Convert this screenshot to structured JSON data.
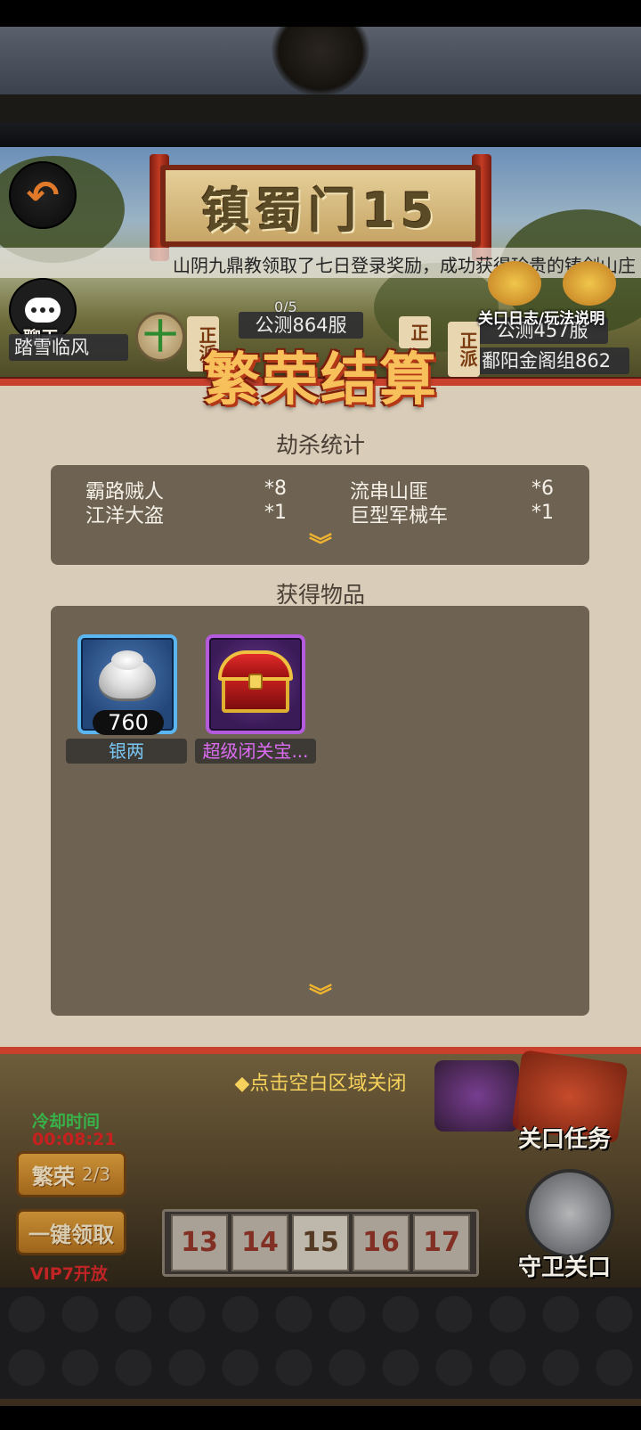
{
  "scene": {
    "back_glyph": "↶",
    "stage_title": "镇蜀门15",
    "broadcast": "山阴九鼎教领取了七日登录奖励，成功获得珍贵的铸剑山庄",
    "chat_label": "聊天",
    "player_name": "踏雪临风",
    "progress": "0/5",
    "server_left": "公测864服",
    "server_right": "公测457服",
    "guild_name": "鄱阳金阁组862",
    "log_label": "关口日志/玩法说明",
    "side_badge_left": "正派",
    "side_badge_mid": "正",
    "side_badge_right": "正派",
    "plus_glyph": "十"
  },
  "modal": {
    "title": "繁荣结算",
    "kill_section_title": "劫杀统计",
    "kills": [
      {
        "name": "霸路贼人",
        "count": "*8"
      },
      {
        "name": "流串山匪",
        "count": "*6"
      },
      {
        "name": "江洋大盗",
        "count": "*1"
      },
      {
        "name": "巨型军械车",
        "count": "*1"
      }
    ],
    "items_section_title": "获得物品",
    "items": [
      {
        "name": "银两",
        "quantity": "760",
        "icon": "silver-ingot-icon",
        "rarity_color": "#5bb5f0"
      },
      {
        "name": "超级闭关宝...",
        "icon": "treasure-chest-icon",
        "rarity_color": "#b45adc"
      }
    ],
    "expand_glyph": "︾",
    "close_hint": "◆点击空白区域关闭"
  },
  "hud": {
    "cooldown_label": "冷却时间",
    "cooldown_time": "00:08:21",
    "prosper_button": "繁荣",
    "prosper_count": "2/3",
    "claim_all_button": "一键领取",
    "vip_note": "VIP7开放",
    "stages": [
      "13",
      "14",
      "15",
      "16",
      "17"
    ],
    "current_stage": "15",
    "mission_label": "关口任务",
    "guard_label": "守卫关口"
  },
  "colors": {
    "modal_bg": "#d9ccb9",
    "modal_border": "#c9412d",
    "panel_bg": "#6e6352",
    "title_gold": "#f7c05a",
    "hint_yellow": "#f6d25c"
  }
}
